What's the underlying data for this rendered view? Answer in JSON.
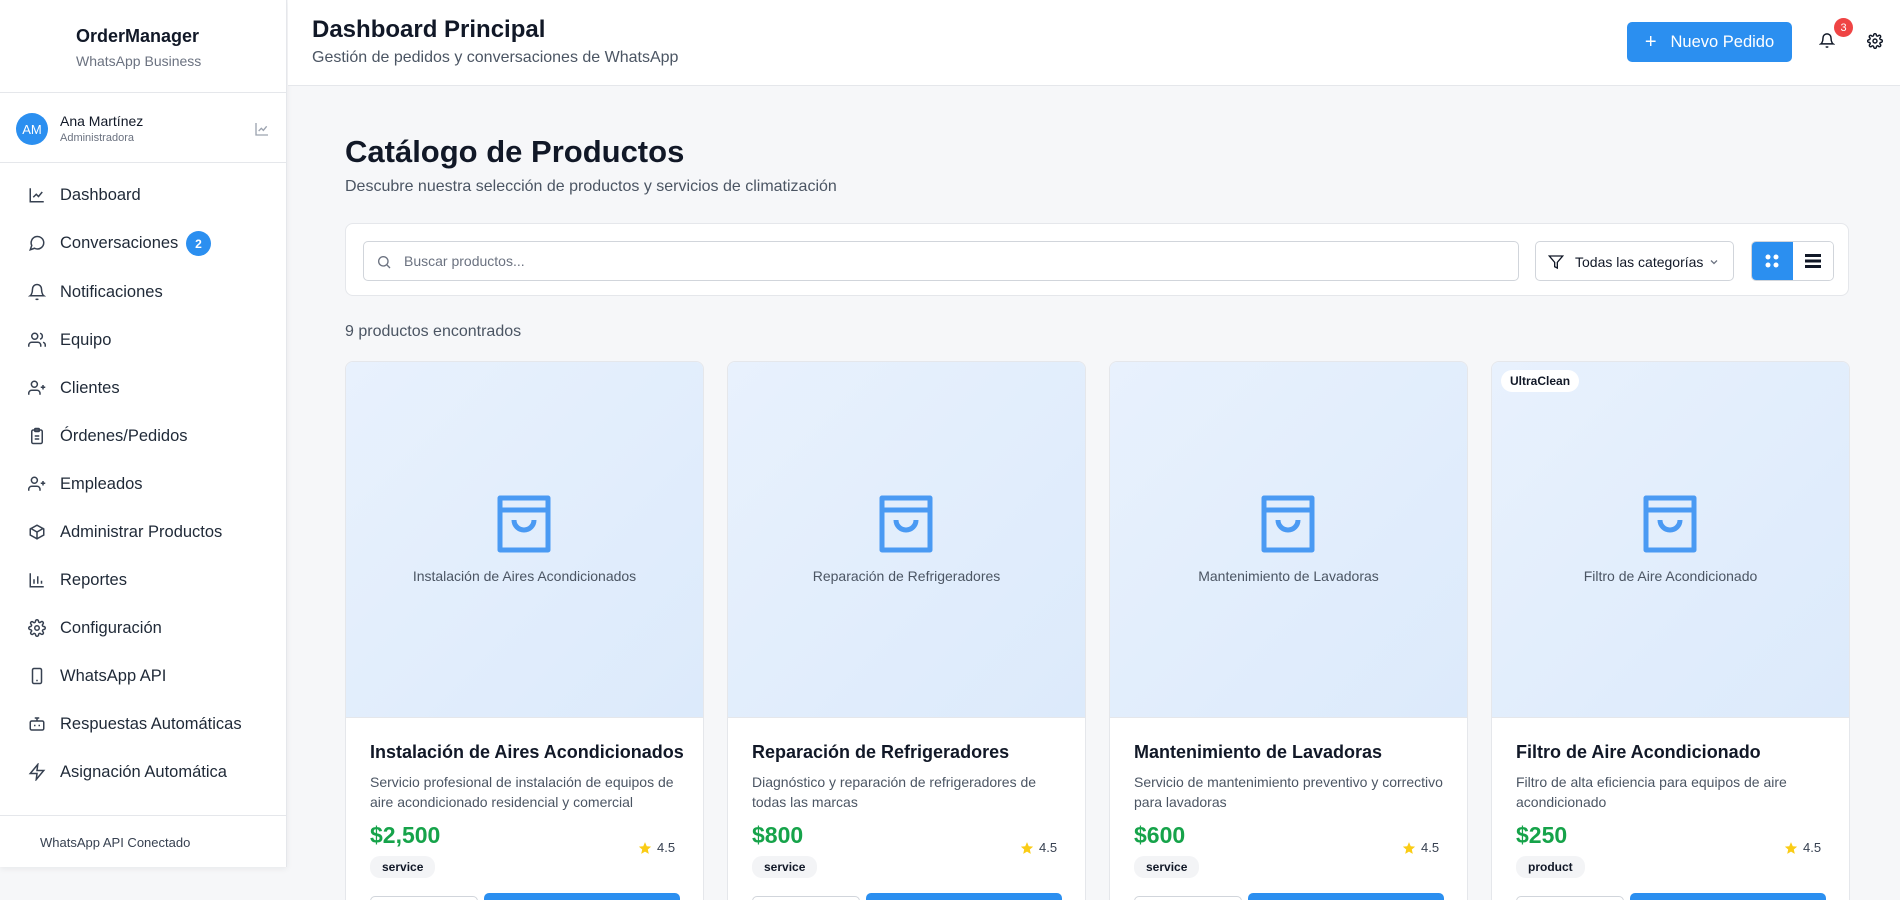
{
  "sidebar": {
    "brand_title": "OrderManager",
    "brand_sub": "WhatsApp Business",
    "user": {
      "initials": "AM",
      "name": "Ana Martínez",
      "role": "Administradora"
    },
    "items": [
      {
        "label": "Dashboard",
        "icon": "chart-line-icon"
      },
      {
        "label": "Conversaciones",
        "icon": "message-icon",
        "badge": "2"
      },
      {
        "label": "Notificaciones",
        "icon": "bell-icon"
      },
      {
        "label": "Equipo",
        "icon": "users-icon"
      },
      {
        "label": "Clientes",
        "icon": "user-plus-icon"
      },
      {
        "label": "Órdenes/Pedidos",
        "icon": "clipboard-icon"
      },
      {
        "label": "Empleados",
        "icon": "user-plus-icon"
      },
      {
        "label": "Administrar Productos",
        "icon": "package-icon"
      },
      {
        "label": "Reportes",
        "icon": "bar-chart-icon"
      },
      {
        "label": "Configuración",
        "icon": "gear-icon"
      },
      {
        "label": "WhatsApp API",
        "icon": "smartphone-icon"
      },
      {
        "label": "Respuestas Automáticas",
        "icon": "bot-icon"
      },
      {
        "label": "Asignación Automática",
        "icon": "zap-icon"
      }
    ],
    "footer": "WhatsApp API Conectado"
  },
  "header": {
    "title": "Dashboard Principal",
    "subtitle": "Gestión de pedidos y conversaciones de WhatsApp",
    "new_order_label": "Nuevo Pedido",
    "notification_count": "3"
  },
  "main": {
    "title": "Catálogo de Productos",
    "subtitle": "Descubre nuestra selección de productos y servicios de climatización",
    "search_placeholder": "Buscar productos...",
    "category_selected": "Todas las categorías",
    "count_text": "9 productos encontrados",
    "products": [
      {
        "image_caption": "Instalación de Aires Acondicionados",
        "name": "Instalación de Aires Acondicionados",
        "description": "Servicio profesional de instalación de equipos de aire acondicionado residencial y comercial",
        "price": "$2,500",
        "rating": "4.5",
        "type": "service",
        "brand": ""
      },
      {
        "image_caption": "Reparación de Refrigeradores",
        "name": "Reparación de Refrigeradores",
        "description": "Diagnóstico y reparación de refrigeradores de todas las marcas",
        "price": "$800",
        "rating": "4.5",
        "type": "service",
        "brand": ""
      },
      {
        "image_caption": "Mantenimiento de Lavadoras",
        "name": "Mantenimiento de Lavadoras",
        "description": "Servicio de mantenimiento preventivo y correctivo para lavadoras",
        "price": "$600",
        "rating": "4.5",
        "type": "service",
        "brand": ""
      },
      {
        "image_caption": "Filtro de Aire Acondicionado",
        "name": "Filtro de Aire Acondicionado",
        "description": "Filtro de alta eficiencia para equipos de aire acondicionado",
        "price": "$250",
        "rating": "4.5",
        "type": "product",
        "brand": "UltraClean"
      }
    ]
  },
  "colors": {
    "accent": "#2b8ff0",
    "price": "#16a34a",
    "badge_red": "#ef4444"
  }
}
